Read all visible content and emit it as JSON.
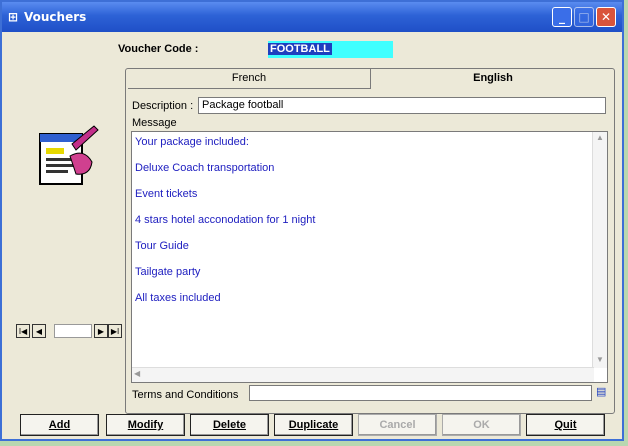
{
  "window": {
    "title": "Vouchers"
  },
  "voucher": {
    "code_label": "Voucher Code :",
    "code_value": "FOOTBALL"
  },
  "tabs": [
    {
      "label": "French",
      "active": false
    },
    {
      "label": "English",
      "active": true
    }
  ],
  "description": {
    "label": "Description :",
    "value": "Package football"
  },
  "message": {
    "label": "Message",
    "lines": [
      "Your package included:",
      "Deluxe Coach transportation",
      "Event tickets",
      "4 stars hotel acconodation for 1 night",
      "Tour Guide",
      "Tailgate party",
      "All taxes included"
    ]
  },
  "terms": {
    "label": "Terms and Conditions",
    "value": ""
  },
  "navigator": {
    "first": "I◀",
    "prev": "◀",
    "next": "▶",
    "last": "▶I"
  },
  "buttons": [
    {
      "label": "Add",
      "enabled": true
    },
    {
      "label": "Modify",
      "enabled": true
    },
    {
      "label": "Delete",
      "enabled": true
    },
    {
      "label": "Duplicate",
      "enabled": true
    },
    {
      "label": "Cancel",
      "enabled": false
    },
    {
      "label": "OK",
      "enabled": false
    },
    {
      "label": "Quit",
      "enabled": true
    }
  ],
  "colors": {
    "title_bar": "#2d62d6",
    "code_bg": "#40ffff",
    "message_text": "#2020c0"
  },
  "icons": [
    "app-icon",
    "minimize-icon",
    "maximize-icon",
    "close-icon",
    "voucher-illustration-icon",
    "terms-lookup-icon"
  ]
}
